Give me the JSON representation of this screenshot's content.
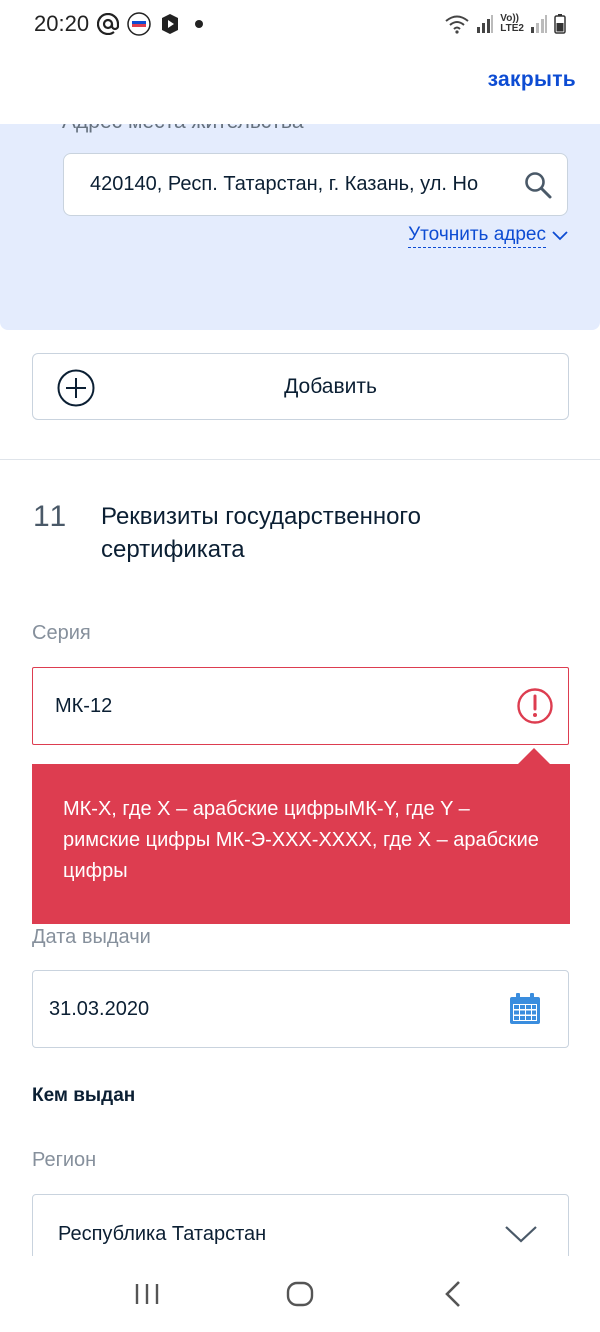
{
  "status_bar": {
    "time": "20:20",
    "icons": [
      "at-icon",
      "gosuslugi-icon",
      "app-icon",
      "notification-dot",
      "wifi-icon",
      "signal-icon",
      "volte-icon",
      "signal2-icon",
      "battery-icon"
    ],
    "volte_text": "Vo))",
    "lte_text": "LTE2"
  },
  "header": {
    "close_label": "закрыть"
  },
  "address": {
    "label": "Адрес места жительства",
    "value": "420140, Респ. Татарстан, г. Казань, ул. Но",
    "refine_label": "Уточнить адрес"
  },
  "add_button": {
    "label": "Добавить"
  },
  "section": {
    "number": "11",
    "title": "Реквизиты государственного сертификата"
  },
  "series": {
    "label": "Серия",
    "value": "МК-12",
    "error_tooltip": "МК-X, где X – арабские цифрыМК-Y, где Y – римские цифры МК-Э-XXX-XXXX, где X – арабские цифры"
  },
  "issue_date": {
    "label": "Дата выдачи",
    "value": "31.03.2020"
  },
  "issued_by": {
    "label": "Кем выдан"
  },
  "region": {
    "label": "Регион",
    "value": "Республика Татарстан"
  },
  "colors": {
    "accent": "#0d4cd3",
    "error": "#dd3d50",
    "address_bg": "#e4ecfd",
    "calendar": "#3a8dde"
  }
}
